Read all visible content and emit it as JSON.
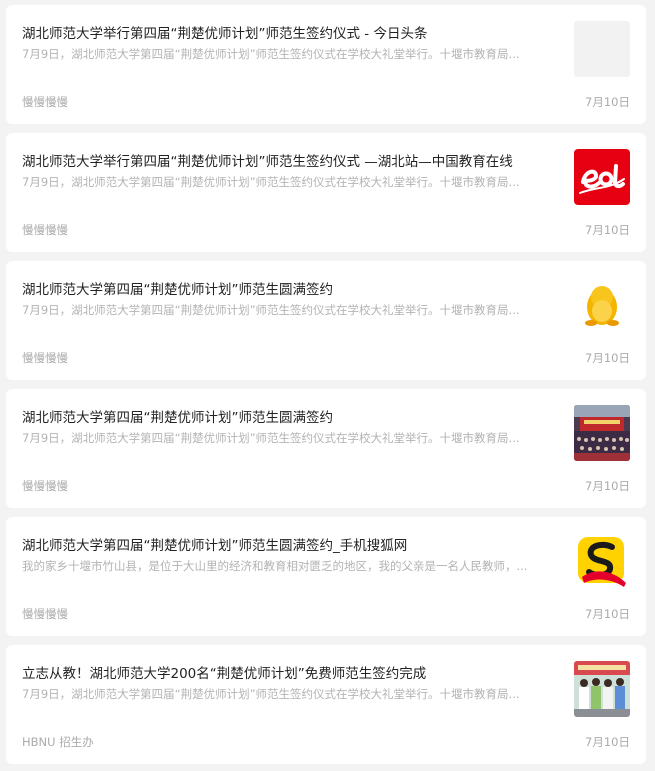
{
  "news": [
    {
      "title": "湖北师范大学举行第四届“荆楚优师计划”师范生签约仪式 - 今日头条",
      "summary": "7月9日，湖北师范大学第四届“荆楚优师计划”师范生签约仪式在学校大礼堂举行。十堰市教育局...",
      "source": "慢慢慢慢",
      "date": "7月10日",
      "thumbnail": "blank-thumbnail"
    },
    {
      "title": "湖北师范大学举行第四届“荆楚优师计划”师范生签约仪式 —湖北站—中国教育在线",
      "summary": "7月9日，湖北师范大学第四届“荆楚优师计划”师范生签约仪式在学校大礼堂举行。十堰市教育局...",
      "source": "慢慢慢慢",
      "date": "7月10日",
      "thumbnail": "eol-logo"
    },
    {
      "title": "湖北师范大学第四届“荆楚优师计划”师范生圆满签约",
      "summary": "7月9日，湖北师范大学第四届“荆楚优师计划”师范生签约仪式在学校大礼堂举行。十堰市教育局...",
      "source": "慢慢慢慢",
      "date": "7月10日",
      "thumbnail": "penguin-logo"
    },
    {
      "title": "湖北师范大学第四届“荆楚优师计划”师范生圆满签约",
      "summary": "7月9日，湖北师范大学第四届“荆楚优师计划”师范生签约仪式在学校大礼堂举行。十堰市教育局...",
      "source": "慢慢慢慢",
      "date": "7月10日",
      "thumbnail": "auditorium-photo"
    },
    {
      "title": "湖北师范大学第四届“荆楚优师计划”师范生圆满签约_手机搜狐网",
      "summary": "我的家乡十堰市竹山县，是位于大山里的经济和教育相对匮乏的地区，我的父亲是一名人民教师，...",
      "source": "慢慢慢慢",
      "date": "7月10日",
      "thumbnail": "sohu-logo"
    },
    {
      "title": "立志从教！湖北师范大学200名“荆楚优师计划”免费师范生签约完成",
      "summary": "7月9日，湖北师范大学第四届“荆楚优师计划”师范生签约仪式在学校大礼堂举行。十堰市教育局...",
      "source": "HBNU 招生办",
      "date": "7月10日",
      "thumbnail": "students-photo"
    }
  ],
  "colors": {
    "background": "#f3f3f3",
    "card": "#ffffff",
    "title": "#222222",
    "summary": "#b3b3b3",
    "meta": "#aaaaaa",
    "eol_red": "#e60012",
    "sohu_yellow": "#ffd200"
  }
}
